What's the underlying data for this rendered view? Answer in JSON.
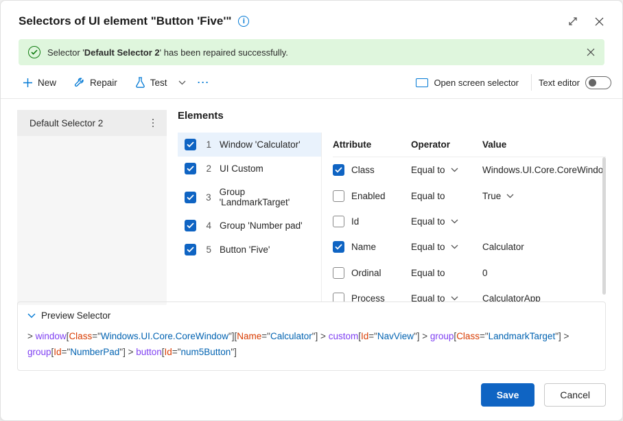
{
  "title": "Selectors of UI element \"Button 'Five'\"",
  "banner": {
    "prefix": "Selector '",
    "name": "Default Selector 2",
    "suffix": "' has been repaired successfully."
  },
  "toolbar": {
    "new_label": "New",
    "repair_label": "Repair",
    "test_label": "Test",
    "screen_selector_label": "Open screen selector",
    "text_editor_label": "Text editor"
  },
  "selectors": [
    {
      "name": "Default Selector 2",
      "selected": true
    }
  ],
  "elements_heading": "Elements",
  "elements": [
    {
      "n": "1",
      "label": "Window 'Calculator'",
      "checked": true,
      "selected": true
    },
    {
      "n": "2",
      "label": "UI Custom",
      "checked": true,
      "selected": false
    },
    {
      "n": "3",
      "label": "Group 'LandmarkTarget'",
      "checked": true,
      "selected": false
    },
    {
      "n": "4",
      "label": "Group 'Number pad'",
      "checked": true,
      "selected": false
    },
    {
      "n": "5",
      "label": "Button 'Five'",
      "checked": true,
      "selected": false
    }
  ],
  "attr_heads": {
    "attribute": "Attribute",
    "operator": "Operator",
    "value": "Value"
  },
  "attributes": [
    {
      "checked": true,
      "name": "Class",
      "operator": "Equal to",
      "op_drop": true,
      "value": "Windows.UI.Core.CoreWindow",
      "val_drop": false
    },
    {
      "checked": false,
      "name": "Enabled",
      "operator": "Equal to",
      "op_drop": false,
      "value": "True",
      "val_drop": true
    },
    {
      "checked": false,
      "name": "Id",
      "operator": "Equal to",
      "op_drop": true,
      "value": "",
      "val_drop": false
    },
    {
      "checked": true,
      "name": "Name",
      "operator": "Equal to",
      "op_drop": true,
      "value": "Calculator",
      "val_drop": false
    },
    {
      "checked": false,
      "name": "Ordinal",
      "operator": "Equal to",
      "op_drop": false,
      "value": "0",
      "val_drop": false
    },
    {
      "checked": false,
      "name": "Process",
      "operator": "Equal to",
      "op_drop": true,
      "value": "CalculatorApp",
      "val_drop": false
    }
  ],
  "preview": {
    "heading": "Preview Selector",
    "tokens": [
      {
        "t": "gt",
        "v": "> "
      },
      {
        "t": "tag",
        "v": "window"
      },
      {
        "t": "br",
        "v": "["
      },
      {
        "t": "attr",
        "v": "Class"
      },
      {
        "t": "br",
        "v": "=\""
      },
      {
        "t": "val",
        "v": "Windows.UI.Core.CoreWindow"
      },
      {
        "t": "br",
        "v": "\"]"
      },
      {
        "t": "br",
        "v": "["
      },
      {
        "t": "attr",
        "v": "Name"
      },
      {
        "t": "br",
        "v": "=\""
      },
      {
        "t": "val",
        "v": "Calculator"
      },
      {
        "t": "br",
        "v": "\"]"
      },
      {
        "t": "gt",
        "v": " > "
      },
      {
        "t": "tag",
        "v": "custom"
      },
      {
        "t": "br",
        "v": "["
      },
      {
        "t": "attr",
        "v": "Id"
      },
      {
        "t": "br",
        "v": "=\""
      },
      {
        "t": "val",
        "v": "NavView"
      },
      {
        "t": "br",
        "v": "\"]"
      },
      {
        "t": "gt",
        "v": " > "
      },
      {
        "t": "tag",
        "v": "group"
      },
      {
        "t": "br",
        "v": "["
      },
      {
        "t": "attr",
        "v": "Class"
      },
      {
        "t": "br",
        "v": "=\""
      },
      {
        "t": "val",
        "v": "LandmarkTarget"
      },
      {
        "t": "br",
        "v": "\"]"
      },
      {
        "t": "gt",
        "v": " > "
      },
      {
        "t": "tag",
        "v": "group"
      },
      {
        "t": "br",
        "v": "["
      },
      {
        "t": "attr",
        "v": "Id"
      },
      {
        "t": "br",
        "v": "=\""
      },
      {
        "t": "val",
        "v": "NumberPad"
      },
      {
        "t": "br",
        "v": "\"]"
      },
      {
        "t": "gt",
        "v": " > "
      },
      {
        "t": "tag",
        "v": "button"
      },
      {
        "t": "br",
        "v": "["
      },
      {
        "t": "attr",
        "v": "Id"
      },
      {
        "t": "br",
        "v": "=\""
      },
      {
        "t": "val",
        "v": "num5Button"
      },
      {
        "t": "br",
        "v": "\"]"
      }
    ]
  },
  "footer": {
    "save": "Save",
    "cancel": "Cancel"
  }
}
